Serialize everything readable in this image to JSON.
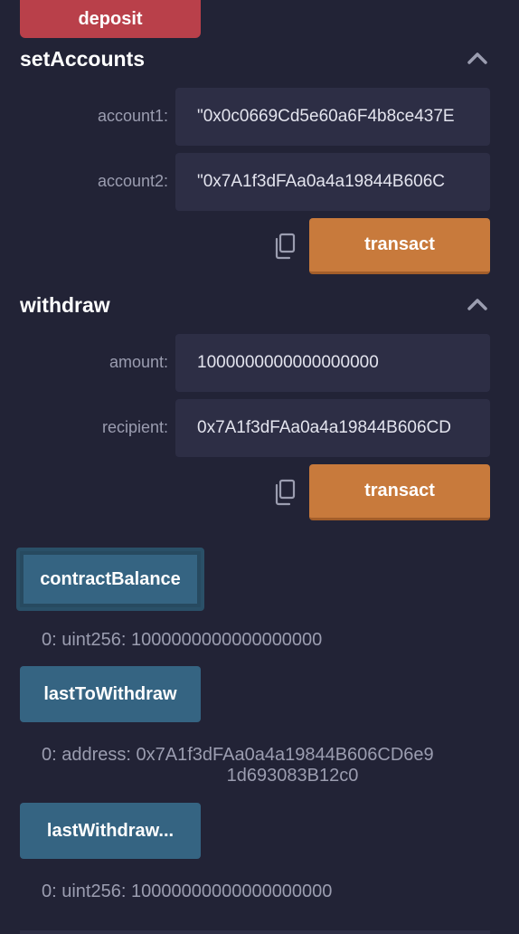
{
  "deposit": {
    "label": "deposit"
  },
  "setAccounts": {
    "title": "setAccounts",
    "fields": [
      {
        "label": "account1:",
        "value": "\"0x0c0669Cd5e60a6F4b8ce437E"
      },
      {
        "label": "account2:",
        "value": "\"0x7A1f3dFAa0a4a19844B606C"
      }
    ],
    "transact_label": "transact"
  },
  "withdraw": {
    "title": "withdraw",
    "fields": [
      {
        "label": "amount:",
        "value": "1000000000000000000"
      },
      {
        "label": "recipient:",
        "value": "0x7A1f3dFAa0a4a19844B606CD"
      }
    ],
    "transact_label": "transact"
  },
  "calls": [
    {
      "label": "contractBalance",
      "result": "0: uint256: 1000000000000000000"
    },
    {
      "label": "lastToWithdraw",
      "result_line1": "0:  address: 0x7A1f3dFAa0a4a19844B606CD6e9",
      "result_line2": "1d693083B12c0"
    },
    {
      "label": "lastWithdraw...",
      "result": "0: uint256: 10000000000000000000"
    }
  ],
  "icons": {
    "collapse": "chevron-up-icon",
    "copy": "copy-icon"
  },
  "colors": {
    "background": "#222336",
    "deposit": "#b9404a",
    "transact": "#c87a3c",
    "call": "#356482"
  }
}
